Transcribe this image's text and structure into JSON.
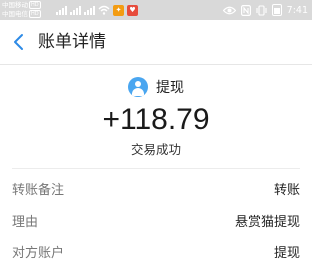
{
  "status_bar": {
    "carrier1": "中国移动",
    "carrier2": "中国电信",
    "hd_label": "HD",
    "signal1_label": "4G",
    "signal2_label": "4G",
    "time": "7:41",
    "badge1_icon": "app-notification-icon",
    "badge2_icon": "app-notification-icon"
  },
  "nav": {
    "title": "账单详情"
  },
  "detail": {
    "name": "提现",
    "amount": "+118.79",
    "status": "交易成功"
  },
  "rows": [
    {
      "label": "转账备注",
      "value": "转账"
    },
    {
      "label": "理由",
      "value": "悬赏猫提现"
    },
    {
      "label": "对方账户",
      "value": "提现"
    }
  ],
  "colors": {
    "status_bar_bg": "#d9d9d9",
    "accent_blue": "#4aa6f0",
    "back_icon": "#2d8ae6"
  }
}
